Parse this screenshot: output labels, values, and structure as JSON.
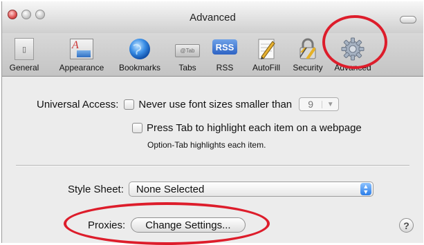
{
  "window": {
    "title": "Advanced"
  },
  "toolbar": {
    "items": [
      {
        "label": "General",
        "icon": "general-icon"
      },
      {
        "label": "Appearance",
        "icon": "appearance-icon"
      },
      {
        "label": "Bookmarks",
        "icon": "bookmarks-globe-icon"
      },
      {
        "label": "Tabs",
        "icon": "tabs-icon"
      },
      {
        "label": "RSS",
        "icon": "rss-icon"
      },
      {
        "label": "AutoFill",
        "icon": "autofill-icon"
      },
      {
        "label": "Security",
        "icon": "security-lock-icon"
      },
      {
        "label": "Advanced",
        "icon": "advanced-gear-icon",
        "selected": true
      }
    ],
    "tabs_icon_text": "@Tab",
    "rss_icon_text": "RSS",
    "appearance_icon_text": "A"
  },
  "universal_access": {
    "label": "Universal Access:",
    "font_size_option": "Never use font sizes smaller than",
    "font_size_value": "9",
    "tab_option": "Press Tab to highlight each item on a webpage",
    "tab_hint": "Option-Tab highlights each item."
  },
  "style_sheet": {
    "label": "Style Sheet:",
    "value": "None Selected"
  },
  "proxies": {
    "label": "Proxies:",
    "button": "Change Settings..."
  },
  "help_label": "?",
  "colors": {
    "annotation_ring": "#dd1d2b",
    "accent": "#2b7de8"
  }
}
